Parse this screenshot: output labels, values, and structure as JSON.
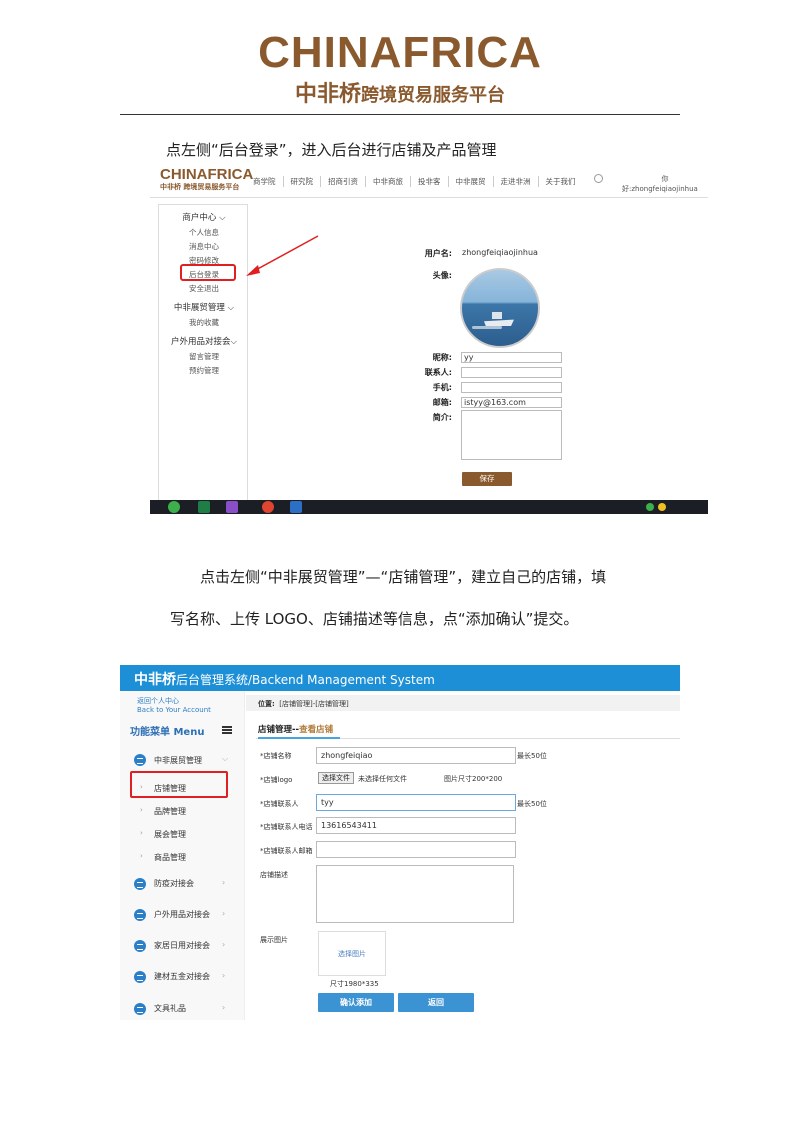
{
  "header": {
    "logo_text": "CHINAFRICA",
    "logo_sub_big": "中非桥",
    "logo_sub_rest": "跨境贸易服务平台"
  },
  "intro": "点左侧“后台登录”，进入后台进行店铺及产品管理",
  "shot1": {
    "logo": "CHINAFRICA",
    "logo_sub": "中非桥 跨境贸易服务平台",
    "nav": [
      "商学院",
      "研究院",
      "招商引资",
      "中非商旅",
      "投非客",
      "中非展贸",
      "走进非洲",
      "关于我们"
    ],
    "user_line1": "你",
    "user_line2": "好:zhongfeiqiaojinhua",
    "sidebar": {
      "group1": "商户中心",
      "group1_items": [
        "个人信息",
        "消息中心",
        "密码修改",
        "后台登录",
        "安全退出"
      ],
      "group2": "中非展贸管理",
      "group2_items": [
        "我的收藏"
      ],
      "group3": "户外用品对接会",
      "group3_items": [
        "留言管理",
        "预约管理"
      ]
    },
    "profile": {
      "username_label": "用户名:",
      "username_value": "zhongfeiqiaojinhua",
      "avatar_label": "头像:",
      "nickname_label": "昵称:",
      "nickname_value": "yy",
      "contact_label": "联系人:",
      "contact_value": "",
      "phone_label": "手机:",
      "phone_value": "",
      "email_label": "邮箱:",
      "email_value": "istyy@163.com",
      "intro_label": "简介:",
      "intro_value": "",
      "save_label": "保存"
    }
  },
  "para2_line1": "点击左侧“中非展贸管理”—“店铺管理”，建立自己的店铺，填",
  "para2_line2": "写名称、上传 LOGO、店铺描述等信息，点“添加确认”提交。",
  "shot2": {
    "title_cn": "中非桥",
    "title_rest": "后台管理系统/Backend Management System",
    "back_line1": "返回个人中心",
    "back_line2": "Back to Your Account",
    "menu_head": "功能菜单 Menu",
    "menu": {
      "group_main": "中非展贸管理",
      "sub_items": [
        "店铺管理",
        "品牌管理",
        "展会管理",
        "商品管理"
      ],
      "groups": [
        "防疫对接会",
        "户外用品对接会",
        "家居日用对接会",
        "建材五金对接会",
        "文具礼品"
      ]
    },
    "crumb_label": "位置:",
    "crumb_value": "[店铺管理]-[店铺管理]",
    "section_title": "店铺管理--",
    "section_accent": "查看店铺",
    "form": {
      "name_label": "*店铺名称",
      "name_value": "zhongfeiqiao",
      "name_note": "最长50位",
      "logo_label": "*店铺logo",
      "file_btn": "选择文件",
      "file_none": "未选择任何文件",
      "logo_note": "图片尺寸200*200",
      "contact_label": "*店铺联系人",
      "contact_value": "tyy",
      "contact_note": "最长50位",
      "phone_label": "*店铺联系人电话",
      "phone_value": "13616543411",
      "email_label": "*店铺联系人邮箱",
      "email_value": "",
      "desc_label": "店铺描述",
      "pic_label": "展示图片",
      "pic_btn": "选择图片",
      "pic_size": "尺寸1980*335",
      "confirm_label": "确认添加",
      "back_label": "返回"
    }
  }
}
